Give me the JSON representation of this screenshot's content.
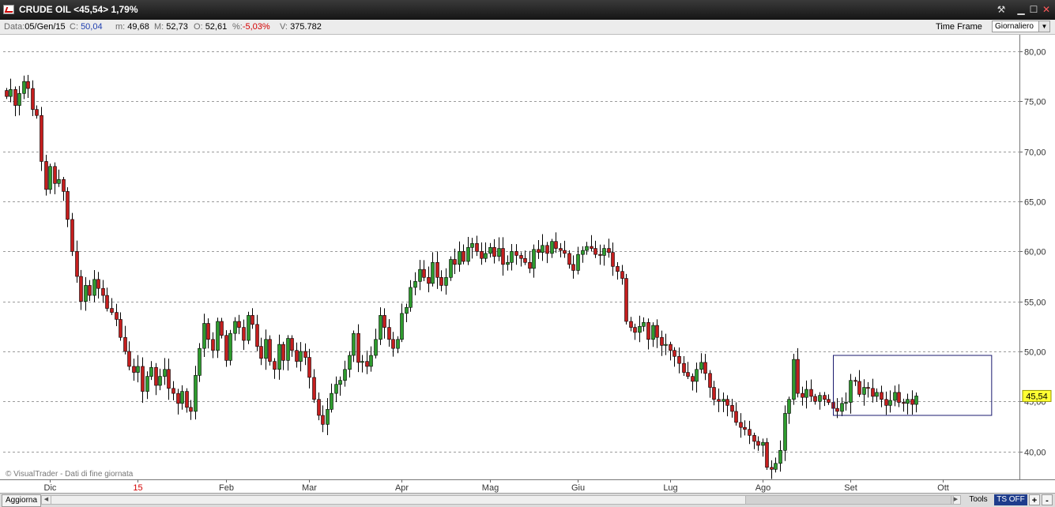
{
  "window": {
    "title": "CRUDE OIL <45,54> 1,79%",
    "pin_icon": "pin-icon",
    "minimize_icon": "minimize-icon",
    "maximize_icon": "maximize-icon",
    "close_icon": "close-icon"
  },
  "infobar": {
    "date_key": "Data:",
    "date_val": "05/Gen/15",
    "close_key": "C:",
    "close_val": "50,04",
    "min_key": "m:",
    "min_val": "49,68",
    "max_key": "M:",
    "max_val": "52,73",
    "open_key": "O:",
    "open_val": "52,61",
    "pct_key": "%:",
    "pct_val": "-5,03%",
    "vol_key": "V:",
    "vol_val": "375.782",
    "timeframe_label": "Time Frame",
    "timeframe_value": "Giornaliero"
  },
  "bottombar": {
    "refresh_label": "Aggiorna",
    "tools_label": "Tools",
    "tsoff_label": "TS OFF",
    "plus_label": "+",
    "minus_label": "-"
  },
  "colors": {
    "up": "#2e9b2e",
    "down": "#c41e1e",
    "wick": "#000000",
    "grid": "#9a9a9a",
    "last_price_bg": "#ffff33",
    "box": "#1a1a6e",
    "red_label": "#d40000"
  },
  "chart_data": {
    "type": "candlestick",
    "title": "CRUDE OIL <45,54> 1,79%",
    "watermark": "© VisualTrader - Dati di fine giornata",
    "ylim": [
      37.2,
      81.2
    ],
    "y_ticks": [
      "80,00",
      "75,00",
      "70,00",
      "65,00",
      "60,00",
      "55,00",
      "50,00",
      "45,00",
      "40,00"
    ],
    "y_tick_values": [
      80,
      75,
      70,
      65,
      60,
      55,
      50,
      45,
      40
    ],
    "last_price": 45.54,
    "last_price_label": "45,54",
    "x_ticks": [
      {
        "label": "Dic",
        "index": 10,
        "red": false
      },
      {
        "label": "15",
        "index": 30,
        "red": true
      },
      {
        "label": "Feb",
        "index": 50,
        "red": false
      },
      {
        "label": "Mar",
        "index": 69,
        "red": false
      },
      {
        "label": "Apr",
        "index": 90,
        "red": false
      },
      {
        "label": "Mag",
        "index": 110,
        "red": false
      },
      {
        "label": "Giu",
        "index": 130,
        "red": false
      },
      {
        "label": "Lug",
        "index": 151,
        "red": false
      },
      {
        "label": "Ago",
        "index": 172,
        "red": false
      },
      {
        "label": "Set",
        "index": 192,
        "red": false
      },
      {
        "label": "Ott",
        "index": 213,
        "red": false
      }
    ],
    "box_range": {
      "start_index": 188,
      "end_index": 224,
      "low": 43.6,
      "high": 49.6
    },
    "closes": [
      75.5,
      76.2,
      74.6,
      75.8,
      77.0,
      76.3,
      74.2,
      73.6,
      69.0,
      66.2,
      68.5,
      66.8,
      67.2,
      66.0,
      63.2,
      60.0,
      57.5,
      55.0,
      56.6,
      55.6,
      57.2,
      56.3,
      55.6,
      54.3,
      53.9,
      53.2,
      51.4,
      50.0,
      48.5,
      47.9,
      48.5,
      46.0,
      47.5,
      48.4,
      46.6,
      47.5,
      48.2,
      46.3,
      45.8,
      44.8,
      46.0,
      44.4,
      44.0,
      47.6,
      50.3,
      52.8,
      51.2,
      50.1,
      53.0,
      51.6,
      49.1,
      51.8,
      53.0,
      52.4,
      51.1,
      53.6,
      52.7,
      50.5,
      49.3,
      51.2,
      49.0,
      48.2,
      50.7,
      49.1,
      51.3,
      50.1,
      49.0,
      50.0,
      49.4,
      47.4,
      45.2,
      43.6,
      42.7,
      44.2,
      45.8,
      46.7,
      47.1,
      48.2,
      49.6,
      51.8,
      48.9,
      49.0,
      48.5,
      49.6,
      51.2,
      53.6,
      52.4,
      51.2,
      50.3,
      51.2,
      53.8,
      54.4,
      56.4,
      57.0,
      58.2,
      57.4,
      56.8,
      58.9,
      57.4,
      56.6,
      57.4,
      59.2,
      58.7,
      60.0,
      59.0,
      60.4,
      60.8,
      60.0,
      59.3,
      59.8,
      60.4,
      59.5,
      60.3,
      58.7,
      58.9,
      60.0,
      59.6,
      59.3,
      58.9,
      58.3,
      60.2,
      59.9,
      60.6,
      59.8,
      61.0,
      60.3,
      60.1,
      59.8,
      58.7,
      58.1,
      59.7,
      60.1,
      60.5,
      60.3,
      59.7,
      59.6,
      60.3,
      59.9,
      58.5,
      58.0,
      57.3,
      53.0,
      52.4,
      51.9,
      52.5,
      52.9,
      51.2,
      52.6,
      51.4,
      50.6,
      50.7,
      50.1,
      49.5,
      48.8,
      47.9,
      47.5,
      47.0,
      48.2,
      48.9,
      47.8,
      46.4,
      45.2,
      45.0,
      45.2,
      44.6,
      44.0,
      42.9,
      42.4,
      42.2,
      41.6,
      41.0,
      40.6,
      40.9,
      38.4,
      38.2,
      38.8,
      40.1,
      43.8,
      45.2,
      49.2,
      45.8,
      45.4,
      46.2,
      45.5,
      45.0,
      45.6,
      45.2,
      44.9,
      44.3,
      44.0,
      44.8,
      44.9,
      47.1,
      47.0,
      45.7,
      46.4,
      46.3,
      45.5,
      45.9,
      45.2,
      44.6,
      45.1,
      45.9,
      44.9,
      44.8,
      45.2,
      44.7,
      45.54
    ]
  }
}
